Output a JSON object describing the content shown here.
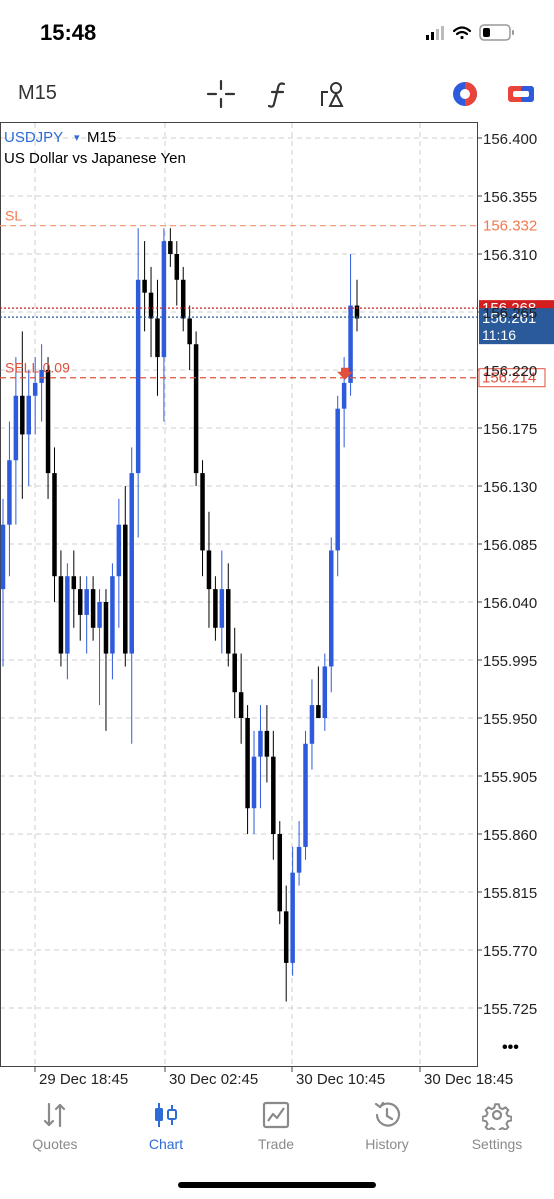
{
  "status_bar": {
    "time": "15:48"
  },
  "toolbar": {
    "timeframe": "M15",
    "tools": [
      "crosshair-icon",
      "indicators-icon",
      "objects-icon",
      "color-theme-icon",
      "trade-icon"
    ]
  },
  "chart": {
    "symbol": "USDJPY",
    "dropdown_glyph": "▾",
    "timeframe": "M15",
    "description": "US Dollar vs Japanese Yen",
    "sl_label": "SL",
    "sell_label": "SELL 0.09",
    "more_glyph": "•••",
    "colors": {
      "bull": "#2e5bdc",
      "bear": "#000000",
      "sl": "#f0a080",
      "sell": "#e0503c",
      "ask": "#d21e1e",
      "bid": "#2a5a9a"
    }
  },
  "chart_data": {
    "type": "candlestick",
    "symbol": "USDJPY",
    "timeframe": "M15",
    "ylim": [
      155.7,
      156.41
    ],
    "price_ticks": [
      "156.400",
      "156.355",
      "156.310",
      "156.265",
      "156.220",
      "156.175",
      "156.130",
      "156.085",
      "156.040",
      "155.995",
      "155.950",
      "155.905",
      "155.860",
      "155.815",
      "155.770",
      "155.725"
    ],
    "time_ticks": [
      "29 Dec 18:45",
      "30 Dec 02:45",
      "30 Dec 10:45",
      "30 Dec 18:45"
    ],
    "levels": {
      "sl": {
        "label": "SL",
        "price": "156.332"
      },
      "ask": {
        "price": "156.268"
      },
      "bid": {
        "price": "156.261",
        "countdown": "11:16"
      },
      "sell": {
        "label": "SELL 0.09",
        "price": "156.214"
      }
    },
    "candles": [
      {
        "o": 156.05,
        "h": 156.12,
        "l": 155.99,
        "c": 156.1
      },
      {
        "o": 156.1,
        "h": 156.18,
        "l": 156.06,
        "c": 156.15
      },
      {
        "o": 156.15,
        "h": 156.23,
        "l": 156.1,
        "c": 156.2
      },
      {
        "o": 156.2,
        "h": 156.25,
        "l": 156.12,
        "c": 156.17
      },
      {
        "o": 156.17,
        "h": 156.22,
        "l": 156.13,
        "c": 156.2
      },
      {
        "o": 156.2,
        "h": 156.23,
        "l": 156.17,
        "c": 156.21
      },
      {
        "o": 156.21,
        "h": 156.24,
        "l": 156.18,
        "c": 156.22
      },
      {
        "o": 156.22,
        "h": 156.23,
        "l": 156.12,
        "c": 156.14
      },
      {
        "o": 156.14,
        "h": 156.16,
        "l": 156.04,
        "c": 156.06
      },
      {
        "o": 156.06,
        "h": 156.08,
        "l": 155.99,
        "c": 156.0
      },
      {
        "o": 156.0,
        "h": 156.07,
        "l": 155.98,
        "c": 156.06
      },
      {
        "o": 156.06,
        "h": 156.08,
        "l": 156.02,
        "c": 156.05
      },
      {
        "o": 156.05,
        "h": 156.06,
        "l": 156.01,
        "c": 156.03
      },
      {
        "o": 156.03,
        "h": 156.06,
        "l": 156.0,
        "c": 156.05
      },
      {
        "o": 156.05,
        "h": 156.06,
        "l": 156.01,
        "c": 156.02
      },
      {
        "o": 156.02,
        "h": 156.05,
        "l": 155.96,
        "c": 156.04
      },
      {
        "o": 156.04,
        "h": 156.05,
        "l": 155.94,
        "c": 156.0
      },
      {
        "o": 156.0,
        "h": 156.07,
        "l": 155.98,
        "c": 156.06
      },
      {
        "o": 156.06,
        "h": 156.12,
        "l": 156.02,
        "c": 156.1
      },
      {
        "o": 156.1,
        "h": 156.13,
        "l": 155.99,
        "c": 156.0
      },
      {
        "o": 156.0,
        "h": 156.16,
        "l": 155.93,
        "c": 156.14
      },
      {
        "o": 156.14,
        "h": 156.33,
        "l": 156.09,
        "c": 156.29
      },
      {
        "o": 156.29,
        "h": 156.32,
        "l": 156.25,
        "c": 156.28
      },
      {
        "o": 156.28,
        "h": 156.3,
        "l": 156.23,
        "c": 156.26
      },
      {
        "o": 156.26,
        "h": 156.29,
        "l": 156.2,
        "c": 156.23
      },
      {
        "o": 156.23,
        "h": 156.33,
        "l": 156.18,
        "c": 156.32
      },
      {
        "o": 156.32,
        "h": 156.33,
        "l": 156.3,
        "c": 156.31
      },
      {
        "o": 156.31,
        "h": 156.32,
        "l": 156.27,
        "c": 156.29
      },
      {
        "o": 156.29,
        "h": 156.3,
        "l": 156.25,
        "c": 156.26
      },
      {
        "o": 156.26,
        "h": 156.27,
        "l": 156.22,
        "c": 156.24
      },
      {
        "o": 156.24,
        "h": 156.25,
        "l": 156.13,
        "c": 156.14
      },
      {
        "o": 156.14,
        "h": 156.15,
        "l": 156.06,
        "c": 156.08
      },
      {
        "o": 156.08,
        "h": 156.11,
        "l": 156.02,
        "c": 156.05
      },
      {
        "o": 156.05,
        "h": 156.06,
        "l": 156.01,
        "c": 156.02
      },
      {
        "o": 156.02,
        "h": 156.08,
        "l": 156.0,
        "c": 156.05
      },
      {
        "o": 156.05,
        "h": 156.07,
        "l": 155.99,
        "c": 156.0
      },
      {
        "o": 156.0,
        "h": 156.02,
        "l": 155.95,
        "c": 155.97
      },
      {
        "o": 155.97,
        "h": 156.0,
        "l": 155.93,
        "c": 155.95
      },
      {
        "o": 155.95,
        "h": 155.96,
        "l": 155.86,
        "c": 155.88
      },
      {
        "o": 155.88,
        "h": 155.94,
        "l": 155.86,
        "c": 155.92
      },
      {
        "o": 155.92,
        "h": 155.96,
        "l": 155.88,
        "c": 155.94
      },
      {
        "o": 155.94,
        "h": 155.96,
        "l": 155.9,
        "c": 155.92
      },
      {
        "o": 155.92,
        "h": 155.94,
        "l": 155.84,
        "c": 155.86
      },
      {
        "o": 155.86,
        "h": 155.87,
        "l": 155.79,
        "c": 155.8
      },
      {
        "o": 155.8,
        "h": 155.82,
        "l": 155.73,
        "c": 155.76
      },
      {
        "o": 155.76,
        "h": 155.85,
        "l": 155.75,
        "c": 155.83
      },
      {
        "o": 155.83,
        "h": 155.87,
        "l": 155.82,
        "c": 155.85
      },
      {
        "o": 155.85,
        "h": 155.94,
        "l": 155.84,
        "c": 155.93
      },
      {
        "o": 155.93,
        "h": 155.98,
        "l": 155.91,
        "c": 155.96
      },
      {
        "o": 155.96,
        "h": 155.99,
        "l": 155.95,
        "c": 155.95
      },
      {
        "o": 155.95,
        "h": 156.0,
        "l": 155.94,
        "c": 155.99
      },
      {
        "o": 155.99,
        "h": 156.09,
        "l": 155.97,
        "c": 156.08
      },
      {
        "o": 156.08,
        "h": 156.2,
        "l": 156.06,
        "c": 156.19
      },
      {
        "o": 156.19,
        "h": 156.23,
        "l": 156.16,
        "c": 156.21
      },
      {
        "o": 156.21,
        "h": 156.31,
        "l": 156.2,
        "c": 156.27
      },
      {
        "o": 156.27,
        "h": 156.29,
        "l": 156.25,
        "c": 156.26
      }
    ]
  },
  "tabs": [
    {
      "label": "Quotes",
      "icon": "quotes-icon",
      "active": false
    },
    {
      "label": "Chart",
      "icon": "chart-icon",
      "active": true
    },
    {
      "label": "Trade",
      "icon": "trade-tab-icon",
      "active": false
    },
    {
      "label": "History",
      "icon": "history-icon",
      "active": false
    },
    {
      "label": "Settings",
      "icon": "settings-icon",
      "active": false
    }
  ]
}
